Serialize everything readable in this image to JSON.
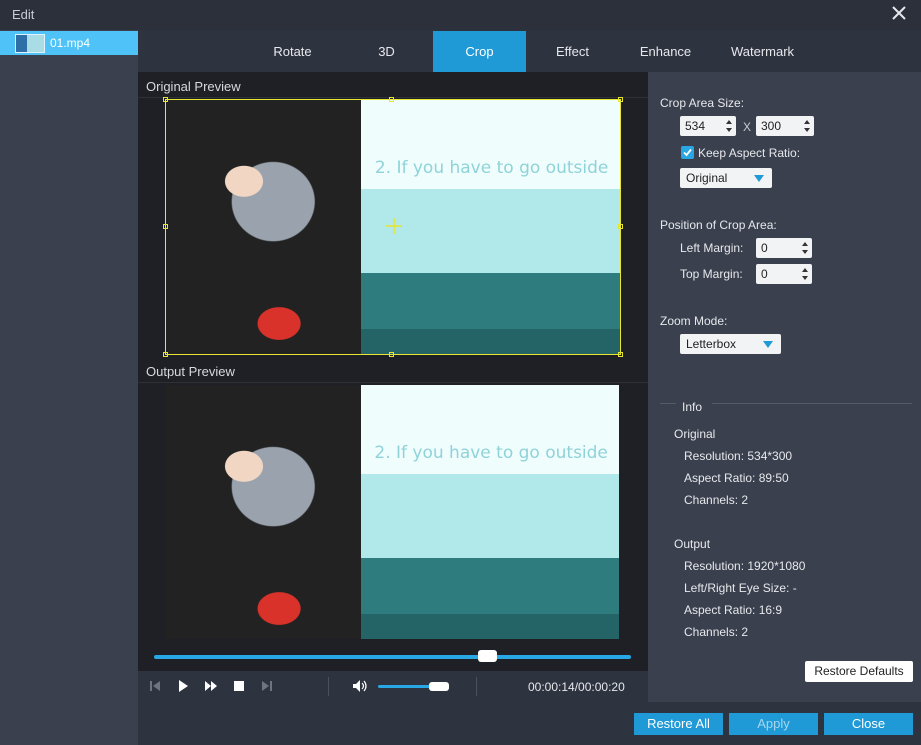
{
  "window": {
    "title": "Edit"
  },
  "files": [
    {
      "name": "01.mp4"
    }
  ],
  "tabs": [
    {
      "label": "Rotate"
    },
    {
      "label": "3D"
    },
    {
      "label": "Crop",
      "active": true
    },
    {
      "label": "Effect"
    },
    {
      "label": "Enhance"
    },
    {
      "label": "Watermark"
    }
  ],
  "preview": {
    "original_label": "Original Preview",
    "output_label": "Output Preview",
    "caption": "2. If you have to go outside"
  },
  "player": {
    "time": "00:00:14/00:00:20",
    "progress_fraction": 0.7,
    "volume_fraction": 0.85
  },
  "crop": {
    "area_size_label": "Crop Area Size:",
    "width": "534",
    "separator": "X",
    "height": "300",
    "keep_aspect_label": "Keep Aspect Ratio:",
    "keep_aspect_checked": true,
    "aspect_value": "Original",
    "position_label": "Position of Crop Area:",
    "left_margin_label": "Left Margin:",
    "left_margin": "0",
    "top_margin_label": "Top Margin:",
    "top_margin": "0",
    "zoom_label": "Zoom Mode:",
    "zoom_value": "Letterbox"
  },
  "info": {
    "title": "Info",
    "original": {
      "heading": "Original",
      "resolution": "Resolution: 534*300",
      "aspect": "Aspect Ratio: 89:50",
      "channels": "Channels: 2"
    },
    "output": {
      "heading": "Output",
      "resolution": "Resolution: 1920*1080",
      "eye_size": "Left/Right Eye Size: -",
      "aspect": "Aspect Ratio: 16:9",
      "channels": "Channels: 2"
    }
  },
  "buttons": {
    "restore_defaults": "Restore Defaults",
    "restore_all": "Restore All",
    "apply": "Apply",
    "close": "Close"
  },
  "colors": {
    "accent": "#1f9ad6",
    "crop_border": "#e7e630",
    "panel": "#3a404d",
    "background": "#2e3340"
  }
}
